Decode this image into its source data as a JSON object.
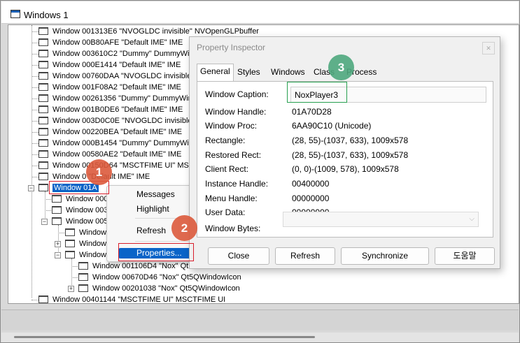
{
  "tab_title": "Windows 1",
  "tree_rows": [
    {
      "text": "Window 001313E6 \"NVOGLDC invisible\" NVOpenGLPbuffer"
    },
    {
      "text": "Window 00B80AFE \"Default IME\" IME"
    },
    {
      "text": "Window 003610C2 \"Dummy\" DummyWin"
    },
    {
      "text": "Window 000E1414 \"Default IME\" IME"
    },
    {
      "text": "Window 00760DAA \"NVOGLDC invisible\""
    },
    {
      "text": "Window 001F08A2 \"Default IME\" IME"
    },
    {
      "text": "Window 00261356 \"Dummy\" DummyWin"
    },
    {
      "text": "Window 001B0DE6 \"Default IME\" IME"
    },
    {
      "text": "Window 003D0C0E \"NVOGLDC invisible\""
    },
    {
      "text": "Window 00220BEA \"Default IME\" IME"
    },
    {
      "text": "Window 000B1454 \"Dummy\" DummyWin"
    },
    {
      "text": "Window 00580AE2 \"Default IME\" IME"
    },
    {
      "text": "Window 00150D64 \"MSCTFIME UI\" MSC"
    },
    {
      "text": "Window 0      \"Default IME\" IME"
    },
    {
      "text": "Window 01A"
    },
    {
      "text": "Window 0003"
    },
    {
      "text": "Window 003E"
    },
    {
      "text": "Window 0053"
    },
    {
      "text": "Window 0"
    },
    {
      "text": "Window 0"
    },
    {
      "text": "Window 0"
    },
    {
      "text": "Window 001106D4 \"Nox\" Qt5"
    },
    {
      "text": "Window 00670D46 \"Nox\" Qt5QWindowIcon"
    },
    {
      "text": "Window 00201038 \"Nox\" Qt5QWindowIcon"
    },
    {
      "text": "Window 00401144 \"MSCTFIME UI\" MSCTFIME UI"
    }
  ],
  "context_menu": {
    "messages": "Messages",
    "highlight": "Highlight",
    "refresh": "Refresh",
    "properties": "Properties..."
  },
  "inspector": {
    "title": "Property Inspector",
    "close_glyph": "✕",
    "tabs": [
      "General",
      "Styles",
      "Windows",
      "Class",
      "Process"
    ],
    "fields": {
      "caption_label": "Window Caption:",
      "caption_value": "NoxPlayer3",
      "handle_label": "Window Handle:",
      "handle_value": "01A70D28",
      "proc_label": "Window Proc:",
      "proc_value": "6AA90C10 (Unicode)",
      "rect_label": "Rectangle:",
      "rect_value": "(28, 55)-(1037, 633), 1009x578",
      "rrect_label": "Restored Rect:",
      "rrect_value": "(28, 55)-(1037, 633), 1009x578",
      "crect_label": "Client Rect:",
      "crect_value": "(0, 0)-(1009, 578), 1009x578",
      "inst_label": "Instance Handle:",
      "inst_value": "00400000",
      "menu_label": "Menu Handle:",
      "menu_value": "00000000",
      "udata_label": "User Data:",
      "udata_value": "00000000",
      "wbytes_label": "Window Bytes:"
    },
    "buttons": {
      "close": "Close",
      "refresh": "Refresh",
      "synchronize": "Synchronize",
      "help": "도움말"
    }
  },
  "badges": {
    "one": "1",
    "two": "2",
    "three": "3"
  },
  "colors": {
    "selection": "#0a64c8",
    "annotation_red": "#d81e2b",
    "annotation_green": "#28a050"
  }
}
